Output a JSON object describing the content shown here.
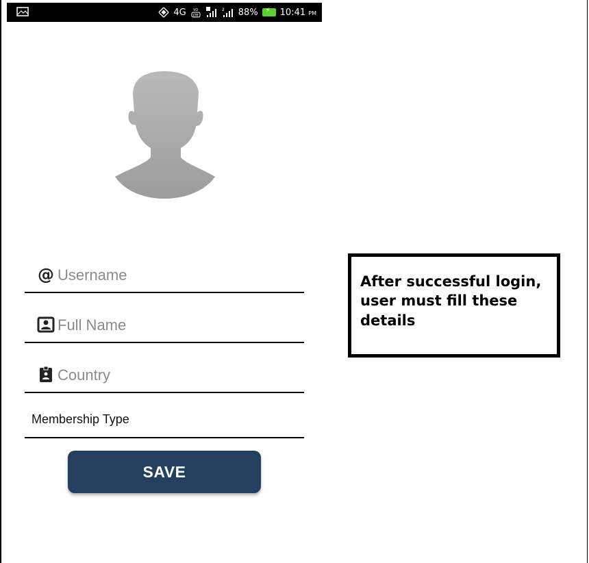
{
  "status_bar": {
    "signal_text": "4G",
    "battery": "88%",
    "time": "10:41",
    "ampm": "PM"
  },
  "form": {
    "username_placeholder": "Username",
    "fullname_placeholder": "Full Name",
    "country_placeholder": "Country",
    "membership_label": "Membership Type",
    "save_label": "SAVE"
  },
  "note": {
    "text": "After successful login, user must fill these details"
  },
  "icons": {
    "avatar": "person-silhouette-icon",
    "username": "at-sign-icon",
    "fullname": "contact-card-icon",
    "country": "badge-icon"
  },
  "colors": {
    "save_button": "#24405e",
    "avatar": "#a9a9a9",
    "placeholder": "#8a8a8a"
  }
}
